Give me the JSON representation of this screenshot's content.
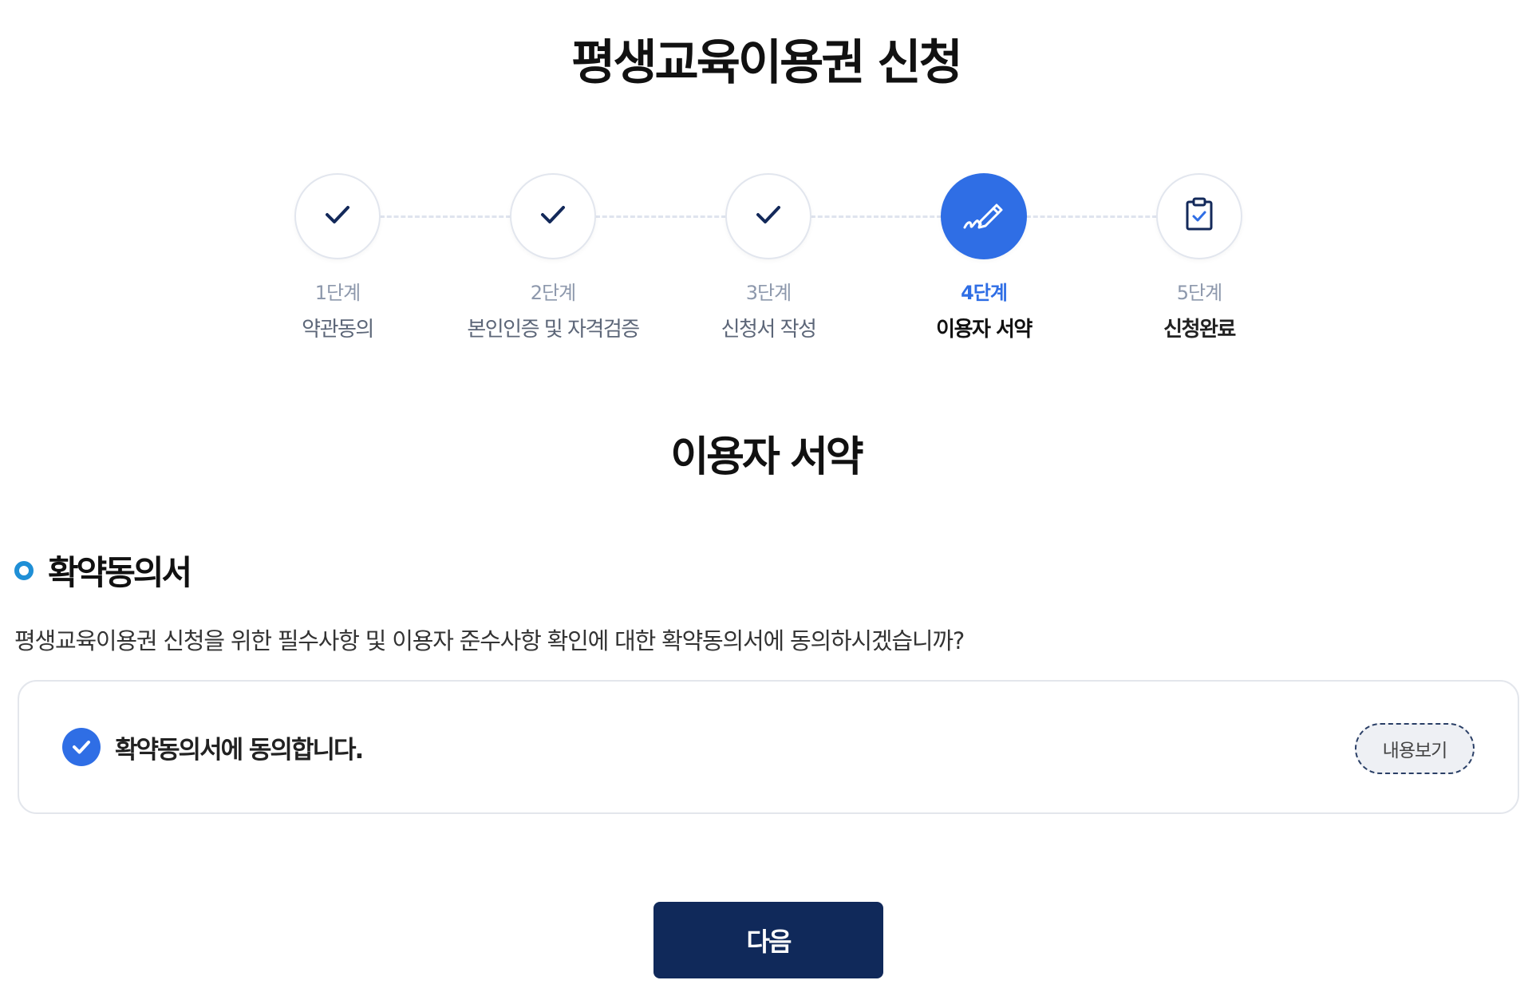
{
  "page": {
    "title": "평생교육이용권 신청"
  },
  "stepper": {
    "steps": [
      {
        "number": "1단계",
        "label": "약관동의",
        "state": "done",
        "icon": "check-icon"
      },
      {
        "number": "2단계",
        "label": "본인인증 및 자격검증",
        "state": "done",
        "icon": "check-icon"
      },
      {
        "number": "3단계",
        "label": "신청서 작성",
        "state": "done",
        "icon": "check-icon"
      },
      {
        "number": "4단계",
        "label": "이용자 서약",
        "state": "active",
        "icon": "pen-sign-icon"
      },
      {
        "number": "5단계",
        "label": "신청완료",
        "state": "pending",
        "icon": "clipboard-check-icon"
      }
    ]
  },
  "section": {
    "title": "이용자 서약"
  },
  "pledge": {
    "title": "확약동의서",
    "description": "평생교육이용권 신청을 위한 필수사항 및 이용자 준수사항 확인에 대한 확약동의서에 동의하시겠습니까?",
    "agree_label": "확약동의서에 동의합니다.",
    "agree_checked": true,
    "view_button": "내용보기"
  },
  "actions": {
    "next_label": "다음"
  },
  "colors": {
    "accent": "#2f6ee5",
    "navy": "#10295a",
    "bullet": "#1f8fd6"
  }
}
